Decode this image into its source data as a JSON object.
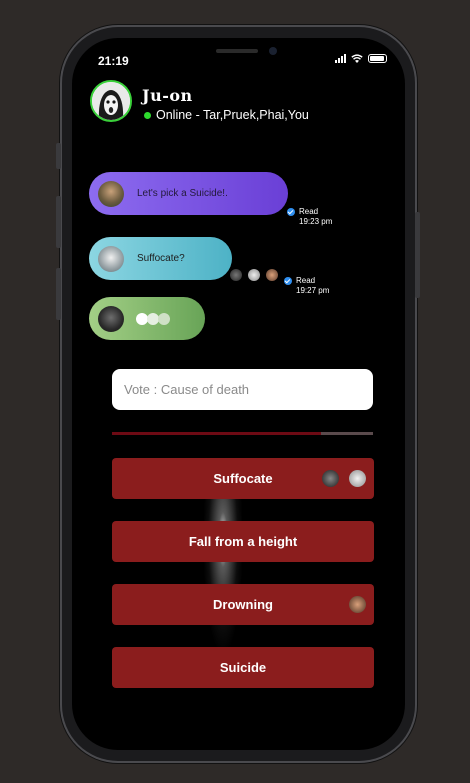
{
  "status": {
    "time": "21:19"
  },
  "header": {
    "group_name": "Ju-on",
    "online_text": "Online - Tar,Pruek,Phai,You"
  },
  "messages": [
    {
      "text": "Let's pick a Suicide!.",
      "read_label": "Read",
      "read_time": "19:23 pm"
    },
    {
      "text": "Suffocate?",
      "read_label": "Read",
      "read_time": "19:27 pm"
    },
    {
      "text": "",
      "typing": true
    }
  ],
  "vote": {
    "placeholder": "Vote : Cause of death",
    "progress": 0.8,
    "options": [
      {
        "label": "Suffocate",
        "voters": 2
      },
      {
        "label": "Fall from a height",
        "voters": 0
      },
      {
        "label": "Drowning",
        "voters": 1
      },
      {
        "label": "Suicide",
        "voters": 0
      }
    ]
  },
  "colors": {
    "bubble_purple": "#7a52e4",
    "bubble_teal": "#6cc4d4",
    "bubble_green": "#86bb6f",
    "option_red": "#8b1d1d",
    "online_green": "#2edb2e"
  }
}
